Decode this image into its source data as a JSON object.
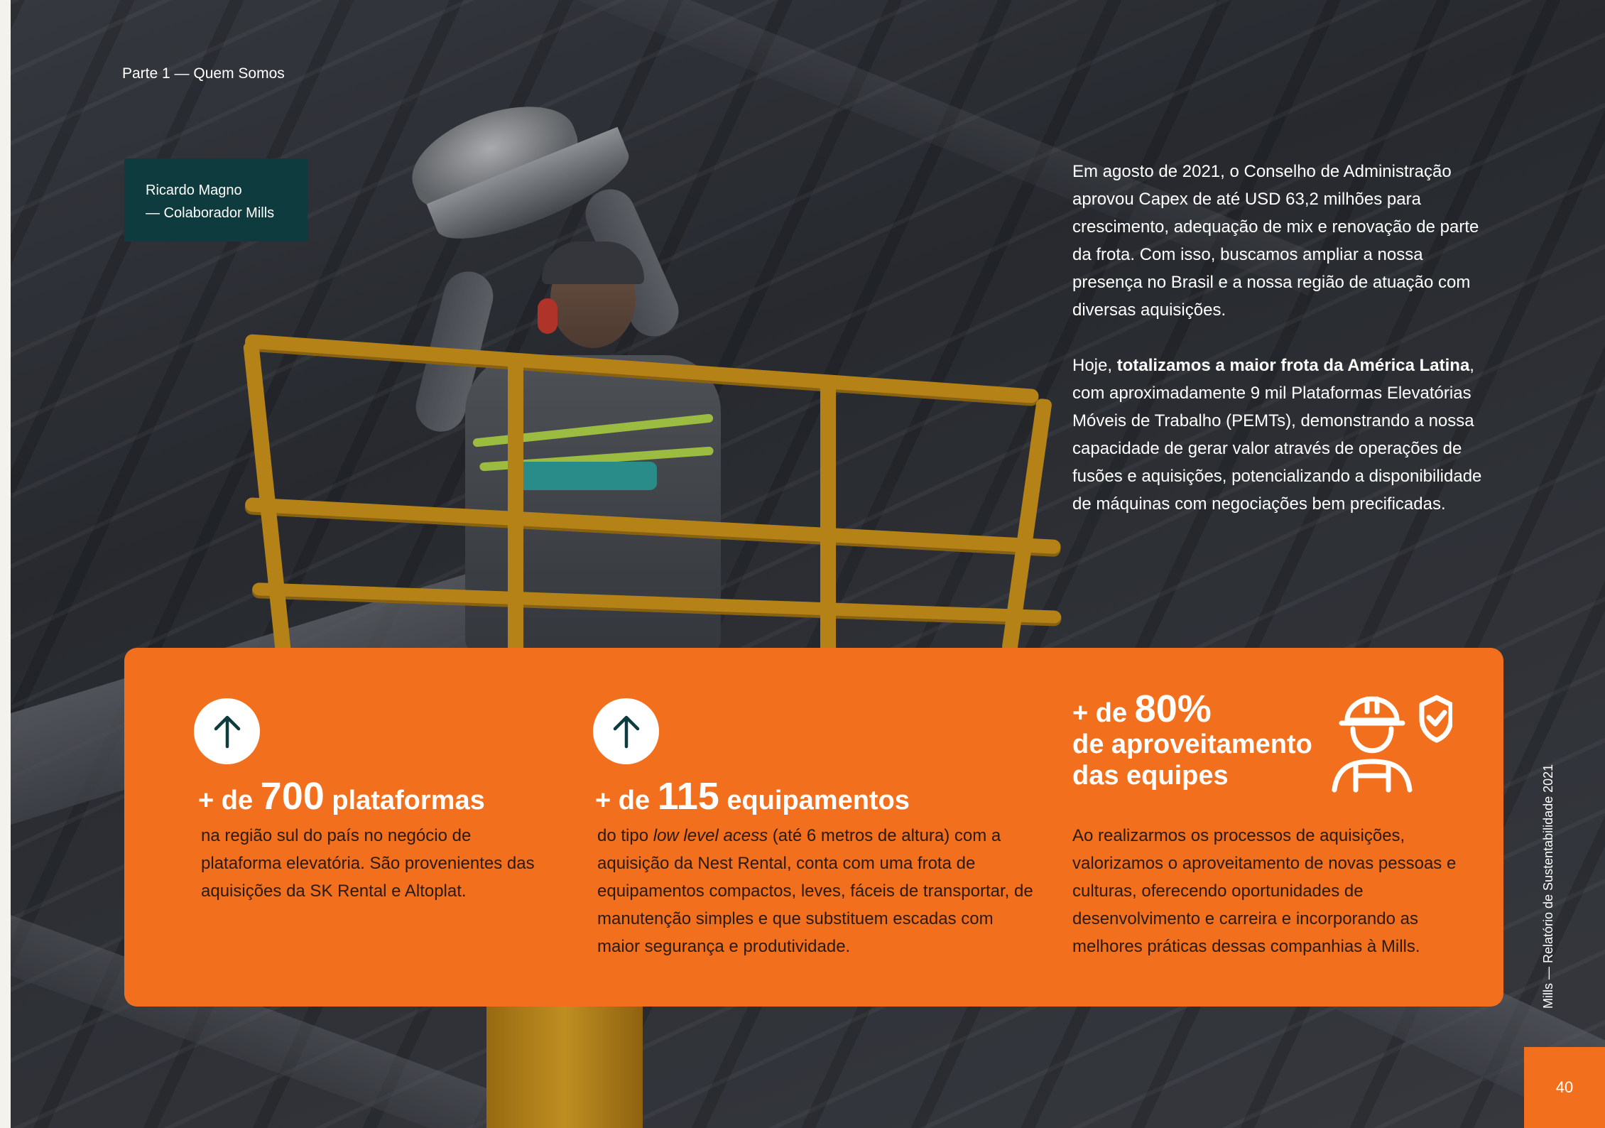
{
  "header": {
    "section": "Parte 1 — Quem Somos"
  },
  "photo_caption": {
    "name": "Ricardo Magno",
    "role": "— Colaborador Mills"
  },
  "intro": {
    "p1": "Em agosto de 2021, o Conselho de Administração aprovou Capex de até USD 63,2 milhões para crescimento, adequação de mix e renovação de parte da frota. Com isso, buscamos ampliar a nossa presença no Brasil e a nossa região de atuação com diversas aquisições.",
    "p2_before": "Hoje, ",
    "p2_bold": "totalizamos a maior frota da América Latina",
    "p2_after": ", com aproximadamente 9 mil Plataformas Elevatórias Móveis de Trabalho (PEMTs), demonstrando a nossa capacidade de gerar valor através de operações de fusões e aquisições, potencializando a disponibilidade de máquinas com negociações bem precificadas."
  },
  "stats": [
    {
      "prefix": "+ de ",
      "number": "700",
      "suffix": " plataformas",
      "text": "na região sul do país no negócio de plataforma elevatória. São provenientes das aquisições da SK Rental e Altoplat.",
      "icon": "arrow-up-icon"
    },
    {
      "prefix": "+ de ",
      "number": "115",
      "suffix": " equipamentos",
      "text_before": "do tipo ",
      "text_italic": "low level acess",
      "text_after": " (até 6 metros de altura) com a aquisição da Nest Rental, conta com uma frota de equipamentos compactos, leves, fáceis de transportar, de manutenção simples e que substituem escadas com maior segurança e produtividade.",
      "icon": "arrow-up-icon"
    },
    {
      "prefix": "+ de ",
      "number": "80%",
      "line2": "de aproveitamento",
      "line3": "das equipes",
      "text": "Ao realizarmos os processos de aquisições, valorizamos o aproveitamento de novas pessoas e culturas, oferecendo oportunidades de desenvolvimento e carreira e incorporando as melhores práticas dessas companhias à Mills.",
      "icon": "worker-shield-icon"
    }
  ],
  "footer": {
    "side_text": "Mills — Relatório de Sustentabilidade 2021",
    "page_number": "40"
  },
  "colors": {
    "accent": "#f2701d",
    "dark_teal": "#0e3b3d",
    "text_dark": "#2a1a10"
  }
}
